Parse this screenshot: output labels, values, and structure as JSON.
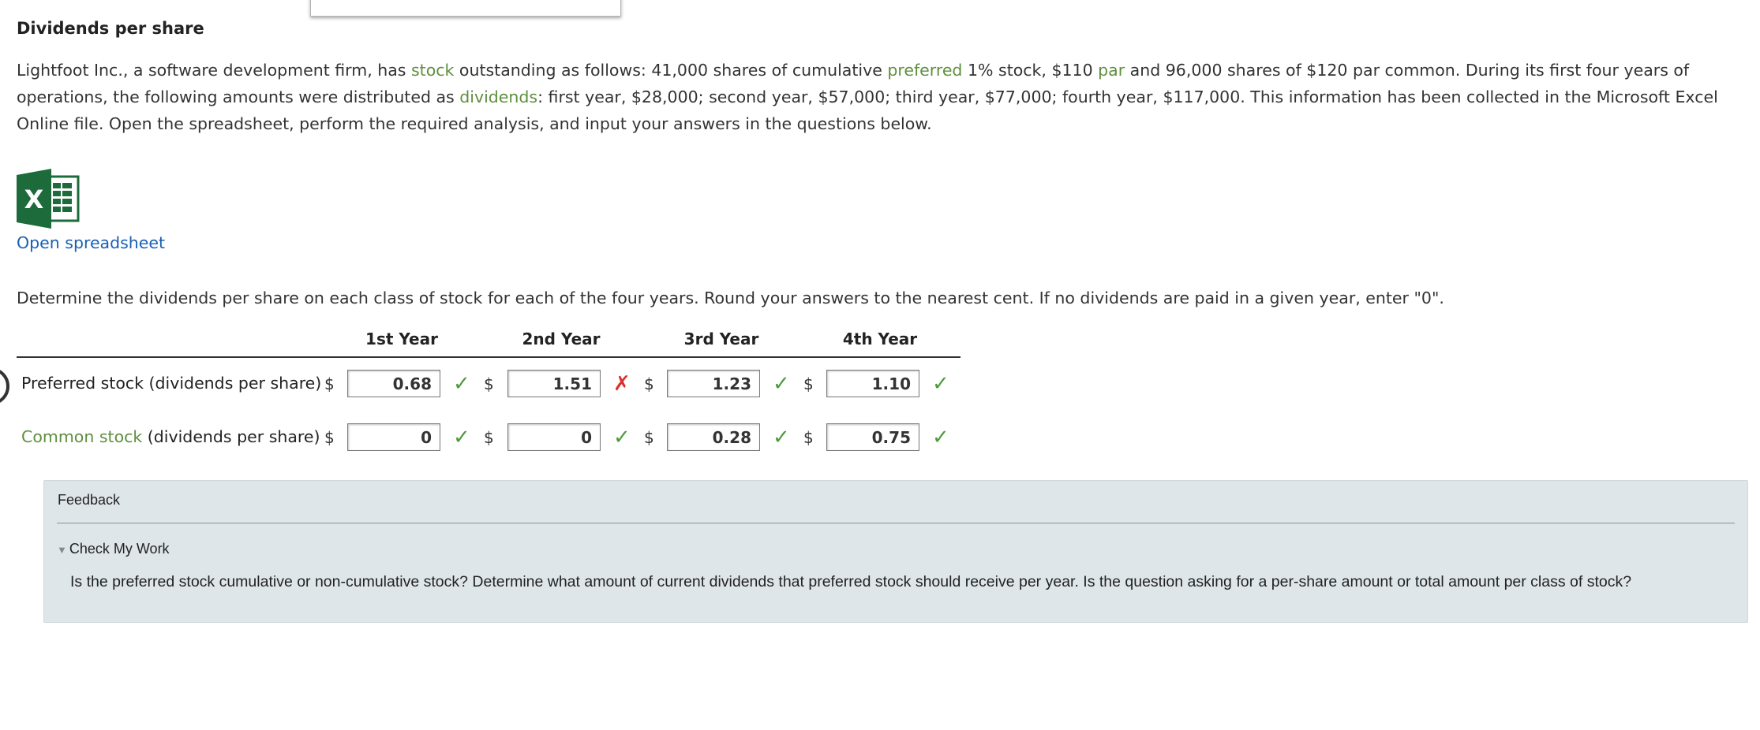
{
  "title": "Dividends per share",
  "intro": {
    "p1": "Lightfoot Inc., a software development firm, has ",
    "kw_stock": "stock",
    "p2": " outstanding as follows: 41,000 shares of cumulative ",
    "kw_preferred": "preferred",
    "p3": " 1% stock, $110 ",
    "kw_par": "par",
    "p4": " and 96,000 shares of $120 par common. During its first four years of operations, the following amounts were distributed as ",
    "kw_dividends": "dividends",
    "p5": ": first year, $28,000; second year, $57,000; third year, $77,000; fourth year, $117,000. This information has been collected in the Microsoft Excel Online file. Open the spreadsheet, perform the required analysis, and input your answers in the questions below."
  },
  "excel_icon": "excel-icon",
  "excel_letter": "X",
  "open_spreadsheet_label": "Open spreadsheet",
  "instruction": "Determine the dividends per share on each class of stock for each of the four years. Round your answers to the nearest cent. If no dividends are paid in a given year, enter \"0\".",
  "table": {
    "currency": "$",
    "columns": [
      "1st Year",
      "2nd Year",
      "3rd Year",
      "4th Year"
    ],
    "rows": [
      {
        "label": "Preferred stock (dividends per share)",
        "values": [
          "0.68",
          "1.51",
          "1.23",
          "1.10"
        ],
        "marks": [
          "correct",
          "incorrect",
          "correct",
          "correct"
        ]
      },
      {
        "label_keyword": "Common stock",
        "label_rest": " (dividends per share)",
        "values": [
          "0",
          "0",
          "0.28",
          "0.75"
        ],
        "marks": [
          "correct",
          "correct",
          "correct",
          "correct"
        ]
      }
    ]
  },
  "symbols": {
    "correct": "✓",
    "incorrect": "✗"
  },
  "colors": {
    "correct": "#4e9a3e",
    "incorrect": "#d9322e",
    "keyword": "#5f8f3e",
    "link": "#1a5fb4",
    "feedback_bg": "#dfe6ea"
  },
  "feedback": {
    "title": "Feedback",
    "toggle_label": "Check My Work",
    "toggle_icon": "triangle-down-icon",
    "text": "Is the preferred stock cumulative or non-cumulative stock? Determine what amount of current dividends that preferred stock should receive per year. Is the question asking for a per-share amount or total amount per class of stock?"
  }
}
